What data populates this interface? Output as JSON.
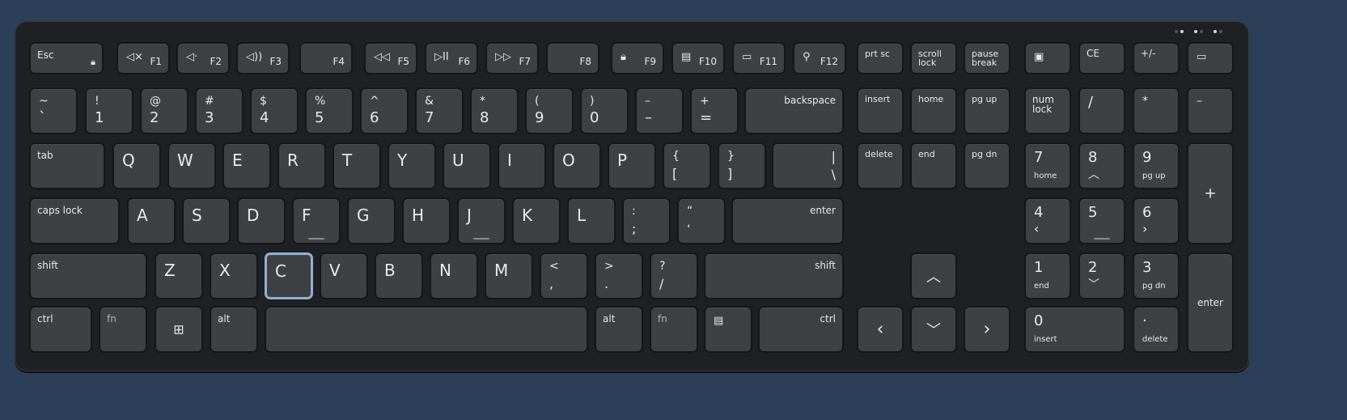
{
  "keyboard": {
    "function_row": {
      "esc": "Esc",
      "f1": "F1",
      "f2": "F2",
      "f3": "F3",
      "f4": "F4",
      "f5": "F5",
      "f6": "F6",
      "f7": "F7",
      "f8": "F8",
      "f9": "F9",
      "f10": "F10",
      "f11": "F11",
      "f12": "F12",
      "prtsc": "prt sc",
      "scroll_lock": "scroll\nlock",
      "pause_break": "pause\nbreak",
      "ce": "CE",
      "plusminus": "+/-"
    },
    "number_row": {
      "tilde": "~",
      "backtick": "`",
      "k1_top": "!",
      "k1": "1",
      "k2_top": "@",
      "k2": "2",
      "k3_top": "#",
      "k3": "3",
      "k4_top": "$",
      "k4": "4",
      "k5_top": "%",
      "k5": "5",
      "k6_top": "^",
      "k6": "6",
      "k7_top": "&",
      "k7": "7",
      "k8_top": "*",
      "k8": "8",
      "k9_top": "(",
      "k9": "9",
      "k0_top": ")",
      "k0": "0",
      "minus_top": "–",
      "minus": "–",
      "equal_top": "+",
      "equal": "=",
      "backspace": "backspace"
    },
    "qwerty_row": {
      "tab": "tab",
      "letters": [
        "Q",
        "W",
        "E",
        "R",
        "T",
        "Y",
        "U",
        "I",
        "O",
        "P"
      ],
      "lbracket_top": "{",
      "lbracket": "[",
      "rbracket_top": "}",
      "rbracket": "]",
      "pipe_top": "|",
      "backslash": "\\"
    },
    "home_row": {
      "caps": "caps lock",
      "letters": [
        "A",
        "S",
        "D",
        "F",
        "G",
        "H",
        "J",
        "K",
        "L"
      ],
      "semi_top": ":",
      "semi": ";",
      "quote_top": "“",
      "quote": "‘",
      "enter": "enter"
    },
    "shift_row": {
      "shift": "shift",
      "letters": [
        "Z",
        "X",
        "C",
        "V",
        "B",
        "N",
        "M"
      ],
      "comma_top": "<",
      "comma": ",",
      "period_top": ">",
      "period": ".",
      "slash_top": "?",
      "slash": "/",
      "rshift": "shift"
    },
    "bottom_row": {
      "ctrl": "ctrl",
      "fn": "fn",
      "alt": "alt",
      "ralt": "alt",
      "rfn": "fn",
      "rctrl": "ctrl"
    },
    "nav": {
      "insert": "insert",
      "home": "home",
      "pgup": "pg up",
      "delete": "delete",
      "end": "end",
      "pgdn": "pg dn"
    },
    "numpad": {
      "numlock": "num\nlock",
      "slash": "/",
      "star": "*",
      "minus": "–",
      "n7": "7",
      "n7_sub": "home",
      "n8": "8",
      "n9": "9",
      "n9_sub": "pg up",
      "plus": "+",
      "n4": "4",
      "n5": "5",
      "n6": "6",
      "n1": "1",
      "n1_sub": "end",
      "n2": "2",
      "n3": "3",
      "n3_sub": "pg dn",
      "enter": "enter",
      "n0": "0",
      "n0_sub": "insert",
      "dot": "·",
      "dot_sub": "delete"
    },
    "colors": {
      "background": "#2b3f58",
      "body": "#1f2023",
      "key": "#3f4042",
      "highlight": "#8fb1d6"
    }
  }
}
